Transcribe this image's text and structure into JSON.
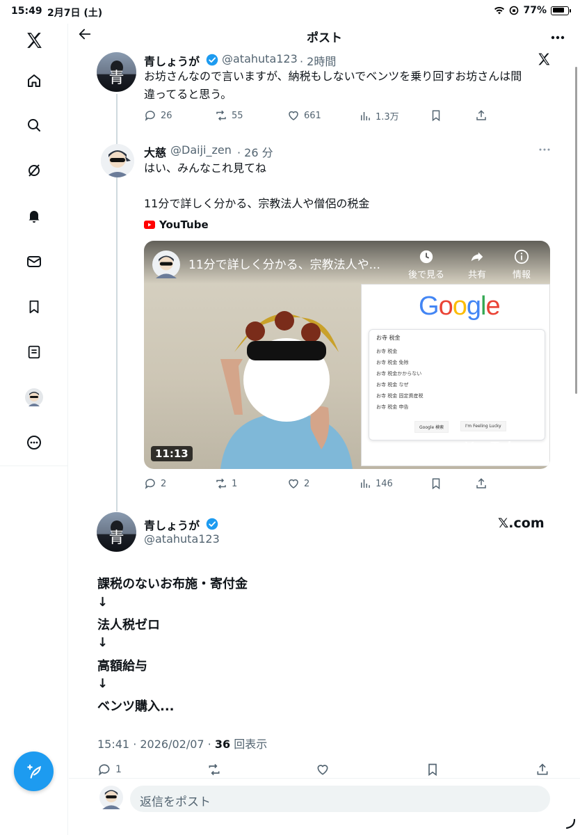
{
  "status_bar": {
    "time": "15:49",
    "date": "2月7日 (土)",
    "battery": "77%"
  },
  "sidebar": {
    "items": [
      {
        "icon": "x-logo-icon"
      },
      {
        "icon": "home-icon"
      },
      {
        "icon": "search-icon"
      },
      {
        "icon": "grok-icon"
      },
      {
        "icon": "bell-icon"
      },
      {
        "icon": "mail-icon"
      },
      {
        "icon": "bookmark-icon"
      },
      {
        "icon": "list-icon"
      },
      {
        "icon": "profile-avatar"
      },
      {
        "icon": "more-circle-icon"
      }
    ],
    "compose_icon": "compose-feather-icon"
  },
  "header": {
    "title": "ポスト"
  },
  "original_post": {
    "name": "青しょうが",
    "handle": "@atahuta123",
    "time": "· 2時間",
    "text_lines": [
      "お坊さんなので言いますが、納税もしないでベンツを乗り回すお坊さんは間",
      "違ってると思う。"
    ],
    "stats": {
      "replies": "26",
      "reposts": "55",
      "likes": "661",
      "views": "1.3万"
    }
  },
  "reply_post": {
    "name": "大慈",
    "handle": "@Daiji_zen",
    "time": "· 26 分",
    "text_lines": [
      "はい、みんなこれ見てね",
      "",
      "11分で詳しく分かる、宗教法人や僧侶の税金"
    ],
    "source": "YouTube",
    "video": {
      "title": "11分で詳しく分かる、宗教法人や...",
      "watch_later": "後で見る",
      "share": "共有",
      "info": "情報",
      "duration": "11:13",
      "google_logo": "Google",
      "search_query": "お寺  税金",
      "suggestions": [
        "お寺 税金",
        "お寺 税金 免除",
        "お寺 税金かからない",
        "お寺 税金 なぜ",
        "お寺 税金 固定資産税",
        "お寺 税金 申告"
      ],
      "google_search_btn": "Google 検索",
      "lucky_btn": "I'm Feeling Lucky",
      "watermark": "YouTube"
    },
    "stats": {
      "replies": "2",
      "reposts": "1",
      "likes": "2",
      "views": "146"
    }
  },
  "main_post": {
    "name": "青しょうが",
    "handle": "@atahuta123",
    "site_badge": "𝕏.com",
    "lines": [
      "課税のないお布施・寄付金",
      "↓",
      "法人税ゼロ",
      "↓",
      "高額給与",
      "↓",
      "ベンツ購入..."
    ],
    "meta_time": "15:41 · 2026/02/07 · ",
    "meta_views": "36",
    "meta_views_label": " 回表示",
    "stats": {
      "replies": "1"
    }
  },
  "reply_bar": {
    "placeholder": "返信をポスト"
  },
  "colors": {
    "accent": "#1d9bf0",
    "verified": "#1d9bf0",
    "text": "#0f1419",
    "muted": "#536471",
    "youtube_red": "#ff0000"
  }
}
